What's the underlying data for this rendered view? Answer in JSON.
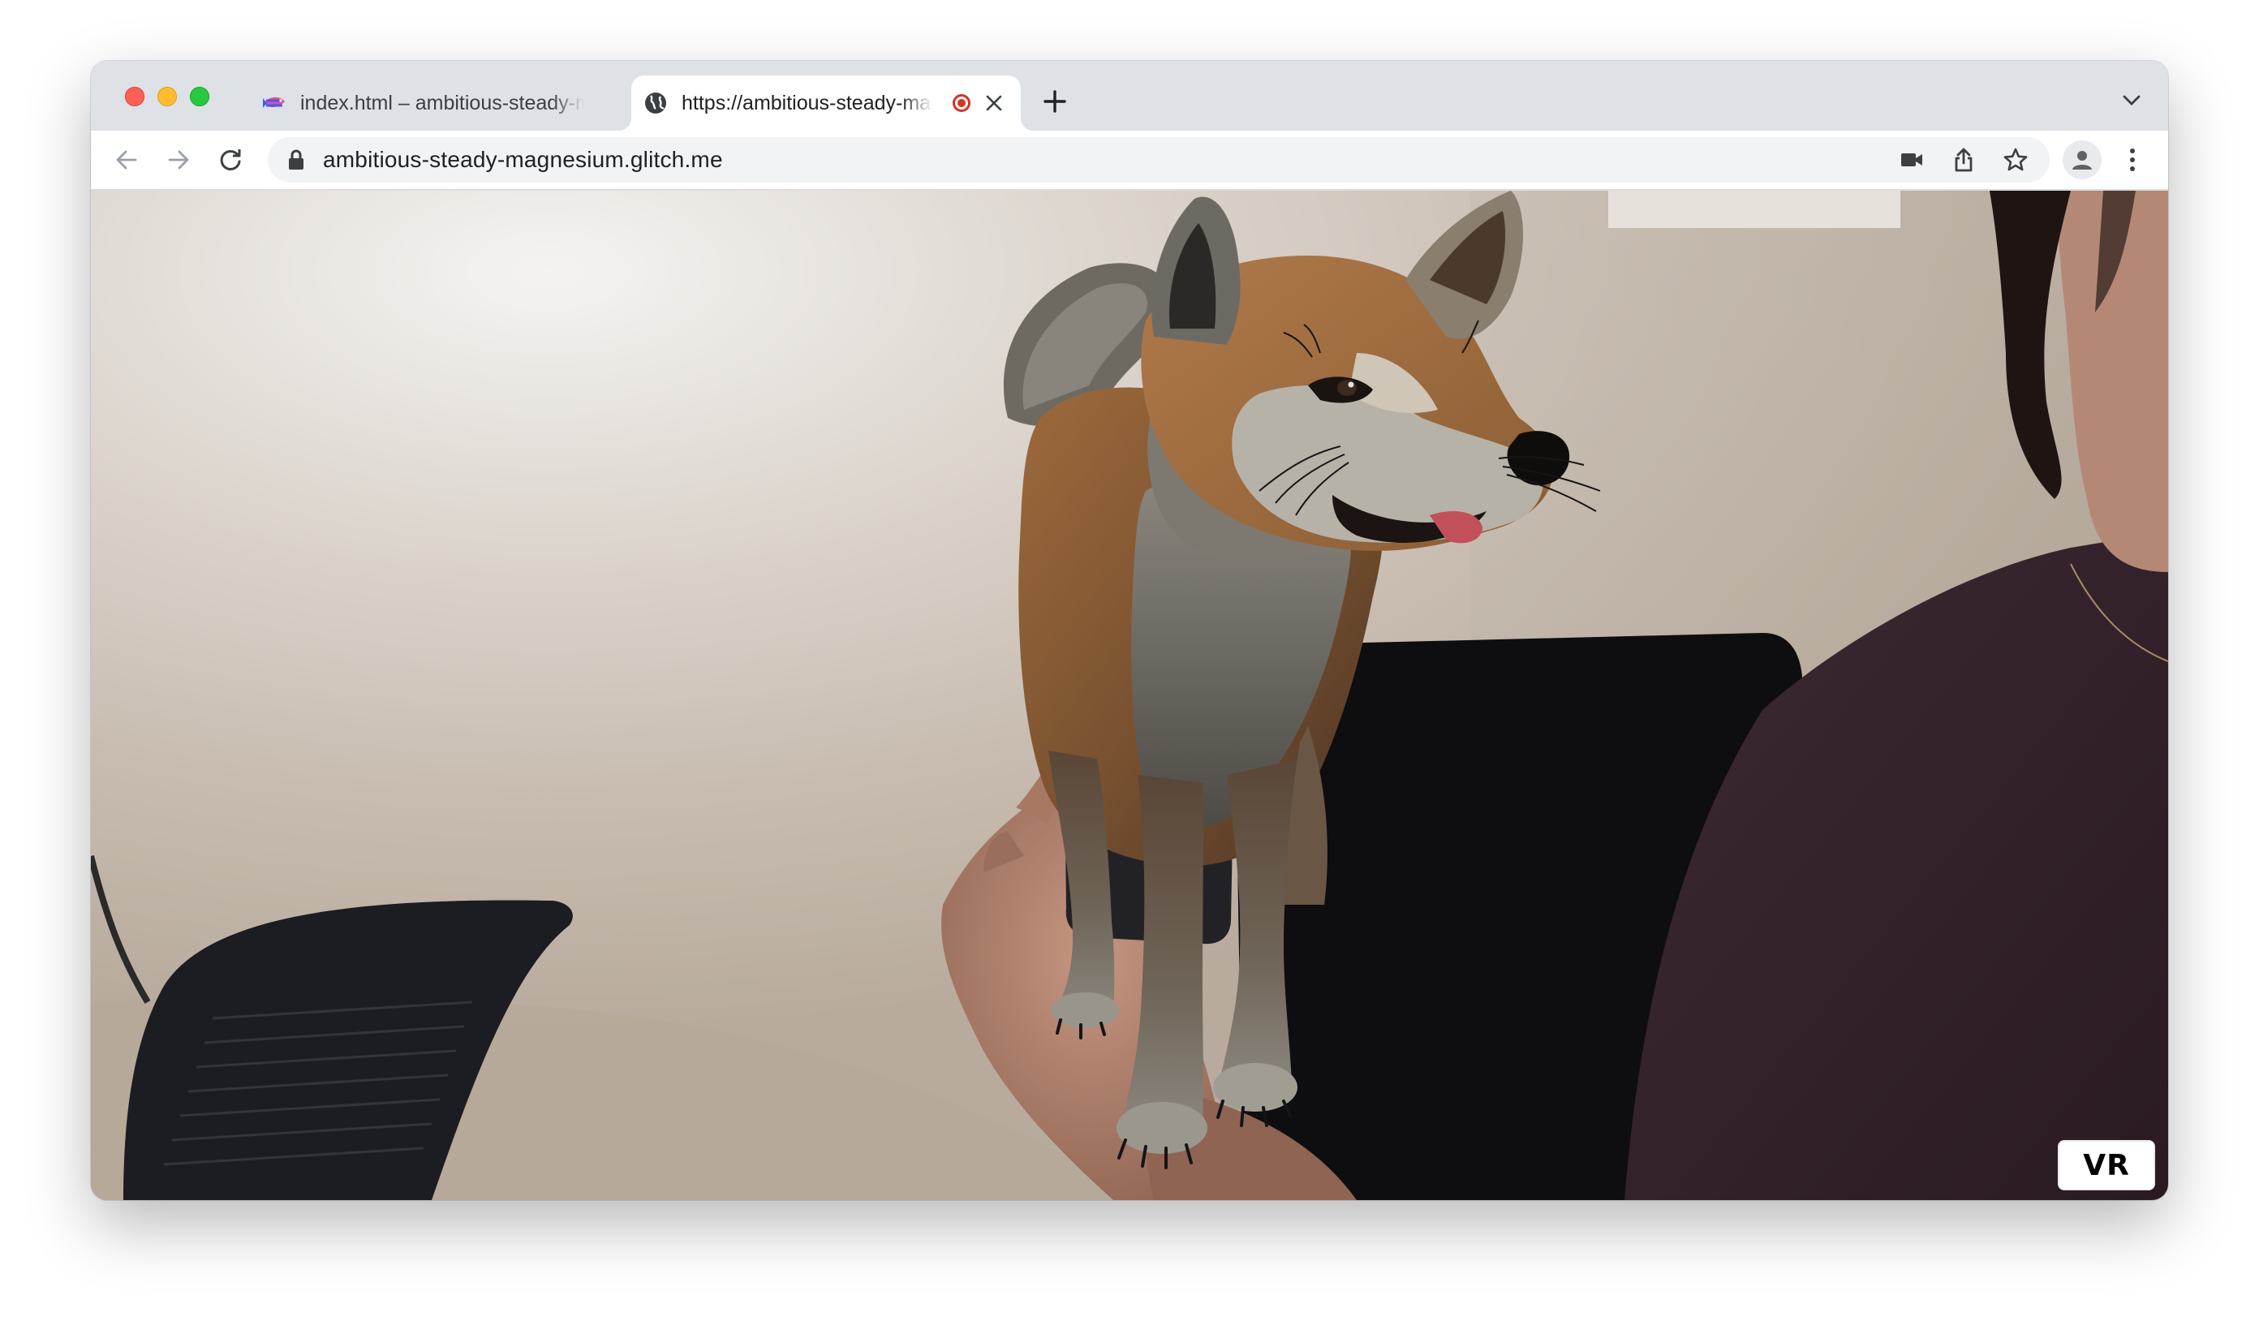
{
  "browser": {
    "tabs": [
      {
        "title": "index.html – ambitious-steady-magnesium",
        "favicon": "glitch-fish-icon",
        "active": false
      },
      {
        "title": "https://ambitious-steady-magnesium.glitch.me",
        "favicon": "globe-icon",
        "active": true,
        "recording": true
      }
    ],
    "address_bar": {
      "url": "ambitious-steady-magnesium.glitch.me"
    },
    "toolbar_icons": [
      "back-icon",
      "forward-icon",
      "reload-icon",
      "lock-icon",
      "camera-icon",
      "share-icon",
      "star-icon",
      "profile-icon",
      "menu-icon"
    ]
  },
  "page": {
    "scene": "AR camera view with 3D shiba inu dog model",
    "vr_button_label": "VR"
  },
  "colors": {
    "tabstrip": "#dee1e6",
    "recording_red": "#d93025",
    "traffic_red": "#ff5f57",
    "traffic_yellow": "#febc2e",
    "traffic_green": "#28c840"
  }
}
